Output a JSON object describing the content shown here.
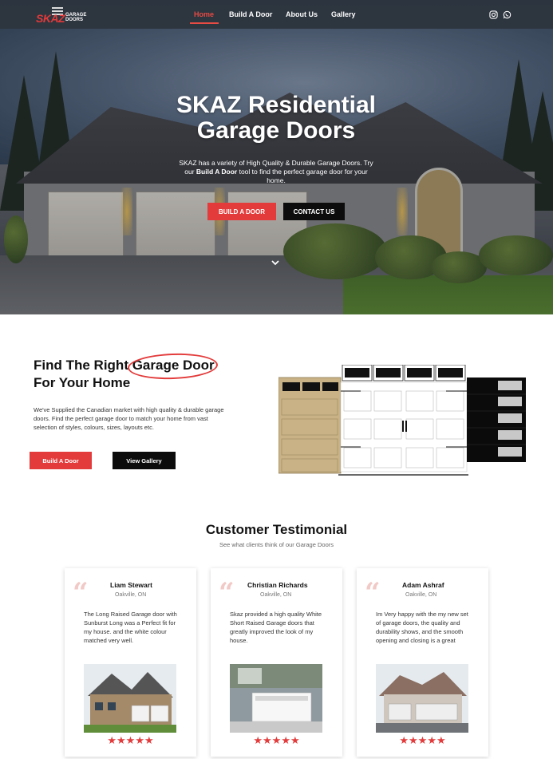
{
  "nav": {
    "logo_text": "SKAZ",
    "logo_sub_1": "GARAGE",
    "logo_sub_2": "DOORS",
    "links": [
      {
        "label": "Home",
        "active": true
      },
      {
        "label": "Build A Door",
        "active": false
      },
      {
        "label": "About Us",
        "active": false
      },
      {
        "label": "Gallery",
        "active": false
      }
    ],
    "social": [
      "instagram-icon",
      "whatsapp-icon"
    ]
  },
  "hero": {
    "title_line1": "SKAZ Residential",
    "title_line2": "Garage Doors",
    "sub_part1": "SKAZ has a variety of High Quality & Durable Garage Doors. Try our ",
    "sub_bold": "Build A Door",
    "sub_part2": " tool to find the perfect garage door for your home.",
    "btn_build": "BUILD A DOOR",
    "btn_contact": "CONTACT US"
  },
  "find": {
    "title_prefix": "Find The Right ",
    "title_highlight": "Garage Door",
    "title_line2": "For Your Home",
    "text": "We've Supplied the Canadian market with high quality & durable garage doors. Find the perfect garage door to match your home from vast selection of styles, colours, sizes, layouts etc.",
    "btn_build": "Build A Door",
    "btn_gallery": "View Gallery"
  },
  "testimonials": {
    "title": "Customer Testimonial",
    "subtitle": "See what clients think of our Garage Doors",
    "cards": [
      {
        "name": "Liam Stewart",
        "location": "Oakville, ON",
        "text": "The Long Raised Garage door with Sunburst Long was a Perfect fit for my house. and the white colour matched very well.",
        "stars": "★★★★★"
      },
      {
        "name": "Christian Richards",
        "location": "Oakville, ON",
        "text": "Skaz provided a high quality White Short Raised Garage doors that greatly improved the look of my house.",
        "stars": "★★★★★"
      },
      {
        "name": "Adam Ashraf",
        "location": "Oakville, ON",
        "text": "Im Very happy with the my new set of garage doors, the quality and durability shows, and the smooth opening and closing is a great",
        "stars": "★★★★★"
      }
    ]
  },
  "colors": {
    "accent": "#e33b3b",
    "dark": "#0c0c0c",
    "nav_bg": "#2d343e"
  }
}
